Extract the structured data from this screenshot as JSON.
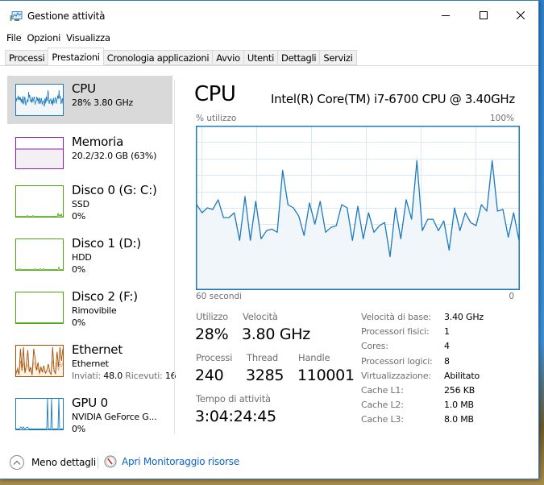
{
  "window": {
    "title": "Gestione attività",
    "controls": {
      "minimize": "minimize-icon",
      "maximize": "maximize-icon",
      "close": "close-icon"
    }
  },
  "menu": [
    "File",
    "Opzioni",
    "Visualizza"
  ],
  "tabs": [
    {
      "label": "Processi",
      "active": false
    },
    {
      "label": "Prestazioni",
      "active": true
    },
    {
      "label": "Cronologia applicazioni",
      "active": false
    },
    {
      "label": "Avvio",
      "active": false
    },
    {
      "label": "Utenti",
      "active": false
    },
    {
      "label": "Dettagli",
      "active": false
    },
    {
      "label": "Servizi",
      "active": false
    }
  ],
  "sidebar": {
    "items": [
      {
        "title": "CPU",
        "sub": "28%  3.80 GHz",
        "sub2": "",
        "active": true,
        "color": "#1c7abf",
        "fill": "#f1f6fb",
        "kind": "cpu"
      },
      {
        "title": "Memoria",
        "sub": "20.2/32.0 GB (63%)",
        "sub2": "",
        "active": false,
        "color": "#8b1fa5",
        "fill": "#f3eff5",
        "kind": "memory",
        "usage_percent": 63
      },
      {
        "title": "Disco 0 (G: C:)",
        "sub": "SSD",
        "sub2": "0%",
        "active": false,
        "color": "#4da60c",
        "fill": "#ffffff",
        "kind": "disk0"
      },
      {
        "title": "Disco 1 (D:)",
        "sub": "HDD",
        "sub2": "0%",
        "active": false,
        "color": "#4da60c",
        "fill": "#ffffff",
        "kind": "disk1"
      },
      {
        "title": "Disco 2 (F:)",
        "sub": "Rimovibile",
        "sub2": "0%",
        "active": false,
        "color": "#4da60c",
        "fill": "#ffffff",
        "kind": "disk2"
      },
      {
        "title": "Ethernet",
        "sub": "Ethernet",
        "sub2_label_sent": "Inviati:",
        "sub2_sent": "48.0",
        "sub2_label_recv": "Ricevuti:",
        "sub2_recv": "16",
        "active": false,
        "color": "#a74f01",
        "fill": "#fcf3eb",
        "kind": "ethernet"
      },
      {
        "title": "GPU 0",
        "sub": "NVIDIA GeForce G...",
        "sub2": "0%",
        "active": false,
        "color": "#1c7abf",
        "fill": "#ffffff",
        "kind": "gpu"
      }
    ]
  },
  "main": {
    "title": "CPU",
    "model": "Intel(R) Core(TM) i7-6700 CPU @ 3.40GHz",
    "axis": {
      "top_left": "% utilizzo",
      "top_right": "100%",
      "bottom_left": "60 secondi",
      "bottom_right": "0"
    },
    "stats": {
      "utilizzo": {
        "label": "Utilizzo",
        "value": "28%"
      },
      "velocita": {
        "label": "Velocità",
        "value": "3.80 GHz"
      },
      "processi": {
        "label": "Processi",
        "value": "240"
      },
      "thread": {
        "label": "Thread",
        "value": "3285"
      },
      "handle": {
        "label": "Handle",
        "value": "110001"
      },
      "uptime": {
        "label": "Tempo di attività",
        "value": "3:04:24:45"
      }
    },
    "specs": [
      {
        "label": "Velocità di base:",
        "value": "3.40 GHz"
      },
      {
        "label": "Processori fisici:",
        "value": "1"
      },
      {
        "label": "Cores:",
        "value": "4"
      },
      {
        "label": "Processori logici:",
        "value": "8"
      },
      {
        "label": "Virtualizzazione:",
        "value": "Abilitato"
      },
      {
        "label": "Cache L1:",
        "value": "256 KB"
      },
      {
        "label": "Cache L2:",
        "value": "1.0 MB"
      },
      {
        "label": "Cache L3:",
        "value": "8.0 MB"
      }
    ]
  },
  "footer": {
    "less_details": "Meno dettagli",
    "resource_monitor": "Apri Monitoraggio risorse"
  },
  "colors": {
    "cpu_line": "#1c7abf",
    "cpu_fill": "#f1f6fb",
    "grid": "#d9e8f5",
    "link": "#0b63c4"
  },
  "chart_data": {
    "type": "area",
    "title": "CPU",
    "xlabel": "60 secondi",
    "ylabel": "% utilizzo",
    "xlim": [
      60,
      0
    ],
    "ylim": [
      0,
      100
    ],
    "grid": true,
    "x_unit": "seconds ago",
    "values": [
      52,
      47,
      50,
      49,
      55,
      44,
      44,
      47,
      30,
      57,
      30,
      54,
      31,
      36,
      37,
      35,
      73,
      52,
      50,
      45,
      33,
      53,
      40,
      54,
      35,
      38,
      39,
      52,
      50,
      30,
      51,
      31,
      47,
      35,
      39,
      41,
      20,
      50,
      31,
      55,
      43,
      79,
      36,
      43,
      43,
      36,
      42,
      24,
      50,
      36,
      47,
      41,
      39,
      52,
      48,
      79,
      48,
      49,
      32,
      47,
      30
    ]
  }
}
